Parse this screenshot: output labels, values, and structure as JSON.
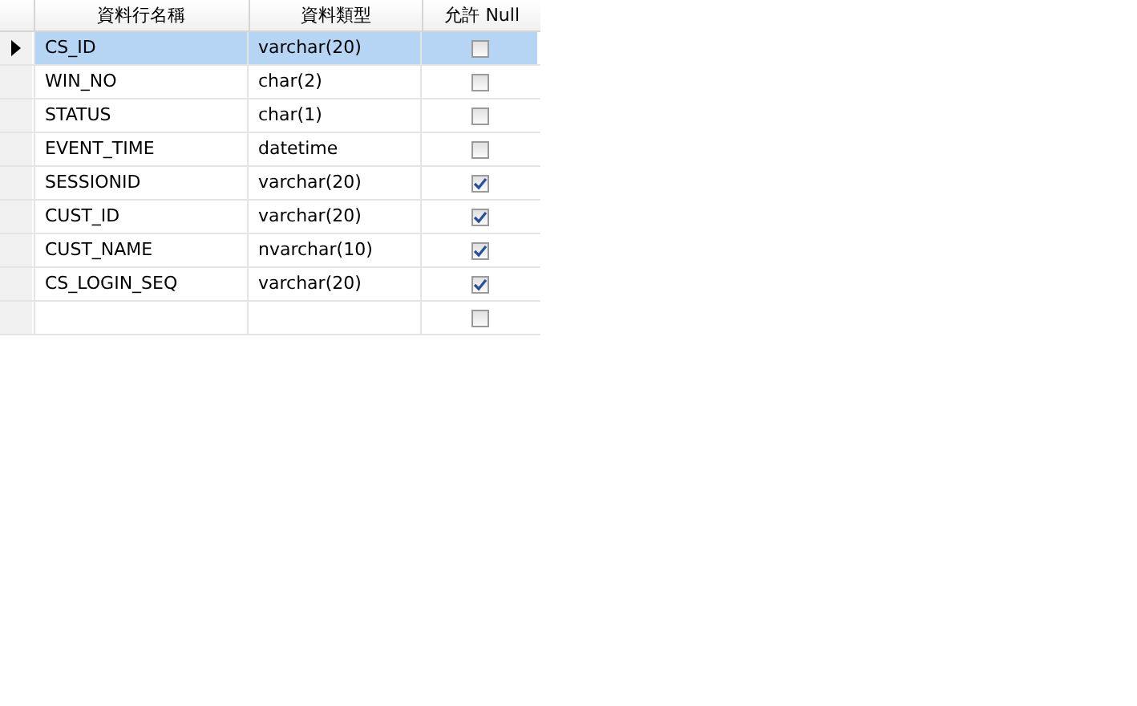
{
  "table": {
    "columns": [
      "資料行名稱",
      "資料類型",
      "允許 Null"
    ],
    "rows": [
      {
        "name": "CS_ID",
        "type": "varchar(20)",
        "allow_null": false,
        "selected": true
      },
      {
        "name": "WIN_NO",
        "type": "char(2)",
        "allow_null": false,
        "selected": false
      },
      {
        "name": "STATUS",
        "type": "char(1)",
        "allow_null": false,
        "selected": false
      },
      {
        "name": "EVENT_TIME",
        "type": "datetime",
        "allow_null": false,
        "selected": false
      },
      {
        "name": "SESSIONID",
        "type": "varchar(20)",
        "allow_null": true,
        "selected": false
      },
      {
        "name": "CUST_ID",
        "type": "varchar(20)",
        "allow_null": true,
        "selected": false
      },
      {
        "name": "CUST_NAME",
        "type": "nvarchar(10)",
        "allow_null": true,
        "selected": false
      },
      {
        "name": "CS_LOGIN_SEQ",
        "type": "varchar(20)",
        "allow_null": true,
        "selected": false
      },
      {
        "allow_null": false,
        "selected": false
      }
    ]
  }
}
